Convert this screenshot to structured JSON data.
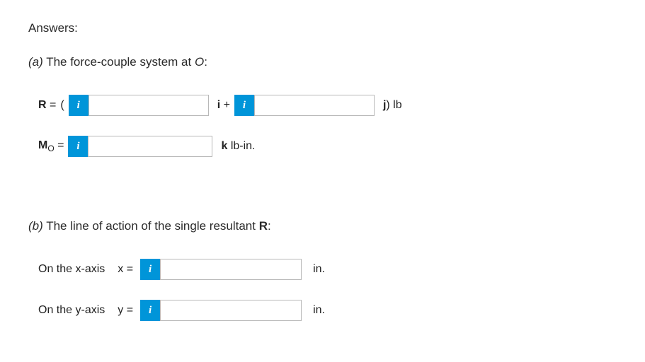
{
  "heading": "Answers:",
  "part_a": {
    "label_prefix": "(a)",
    "label_text": " The force-couple system at ",
    "label_point": "O",
    "label_suffix": ":",
    "row1": {
      "prefix": "R",
      "equals": " = ",
      "open_paren": "(",
      "info": "i",
      "vec_i": "i",
      "plus": " + ",
      "info2": "i",
      "vec_j": "j",
      "close_unit": ") lb"
    },
    "row2": {
      "prefix": "M",
      "sub": "O",
      "equals": " = ",
      "info": "i",
      "vec_k": "k",
      "unit": " lb-in."
    }
  },
  "part_b": {
    "label_prefix": "(b)",
    "label_text": " The line of action of the single resultant ",
    "label_bold": "R",
    "label_suffix": ":",
    "row1": {
      "axis_text": "On the ",
      "axis_var": "x",
      "axis_suffix": "-axis",
      "var": "x",
      "equals": " = ",
      "info": "i",
      "unit": "in."
    },
    "row2": {
      "axis_text": "On the ",
      "axis_var": "y",
      "axis_suffix": "-axis",
      "var": "y",
      "equals": " = ",
      "info": "i",
      "unit": "in."
    }
  }
}
